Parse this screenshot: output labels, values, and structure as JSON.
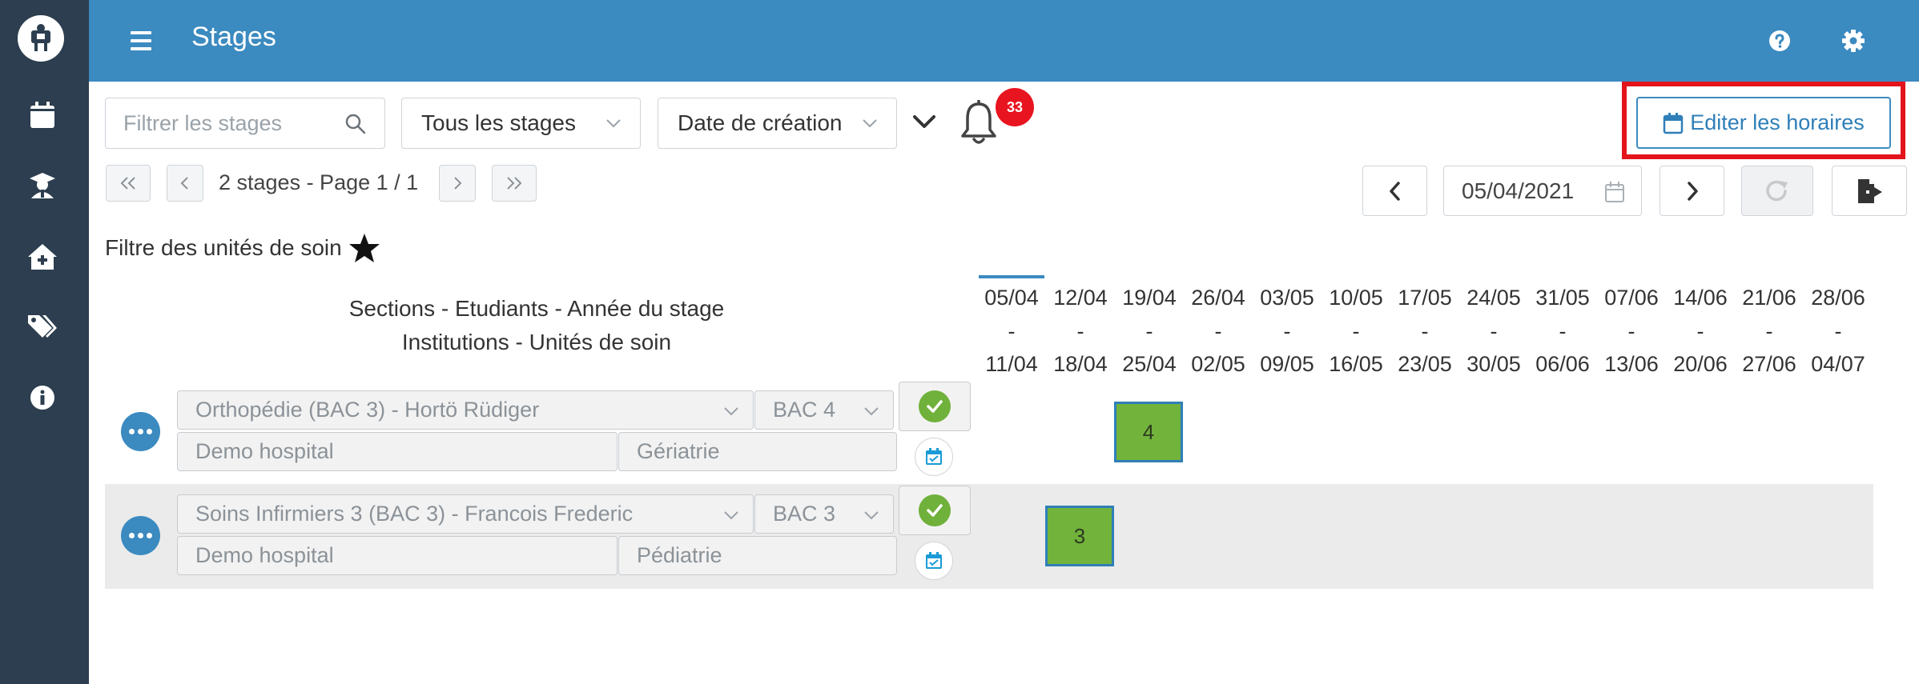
{
  "header": {
    "title": "Stages"
  },
  "toolbar": {
    "search_placeholder": "Filtrer les stages",
    "stage_filter": "Tous les stages",
    "sort_by": "Date de création",
    "notification_count": "33",
    "edit_schedule_label": "Editer les horaires"
  },
  "pager": {
    "summary": "2 stages - Page 1 / 1"
  },
  "date_nav": {
    "date": "05/04/2021"
  },
  "filters": {
    "title": "Filtre des unités de soin"
  },
  "columns": {
    "header_line1": "Sections - Etudiants - Année du stage",
    "header_line2": "Institutions - Unités de soin"
  },
  "weeks": [
    {
      "start": "05/04",
      "sep": "-",
      "end": "11/04"
    },
    {
      "start": "12/04",
      "sep": "-",
      "end": "18/04"
    },
    {
      "start": "19/04",
      "sep": "-",
      "end": "25/04"
    },
    {
      "start": "26/04",
      "sep": "-",
      "end": "02/05"
    },
    {
      "start": "03/05",
      "sep": "-",
      "end": "09/05"
    },
    {
      "start": "10/05",
      "sep": "-",
      "end": "16/05"
    },
    {
      "start": "17/05",
      "sep": "-",
      "end": "23/05"
    },
    {
      "start": "24/05",
      "sep": "-",
      "end": "30/05"
    },
    {
      "start": "31/05",
      "sep": "-",
      "end": "06/06"
    },
    {
      "start": "07/06",
      "sep": "-",
      "end": "13/06"
    },
    {
      "start": "14/06",
      "sep": "-",
      "end": "20/06"
    },
    {
      "start": "21/06",
      "sep": "-",
      "end": "27/06"
    },
    {
      "start": "28/06",
      "sep": "-",
      "end": "04/07"
    }
  ],
  "stages": [
    {
      "section_student": "Orthopédie (BAC 3) - Hortö Rüdiger",
      "year": "BAC 4",
      "institution": "Demo hospital",
      "unit": "Gériatrie",
      "week_index": 2,
      "cell_value": "4"
    },
    {
      "section_student": "Soins Infirmiers 3 (BAC 3) - Francois Frederic",
      "year": "BAC 3",
      "institution": "Demo hospital",
      "unit": "Pédiatrie",
      "week_index": 1,
      "cell_value": "3"
    }
  ],
  "colors": {
    "topbar": "#3b8ac0",
    "sidebar": "#2c3e4f",
    "cell_green": "#72b33c",
    "badge_red": "#e8141f",
    "highlight_red": "#e3141b"
  }
}
